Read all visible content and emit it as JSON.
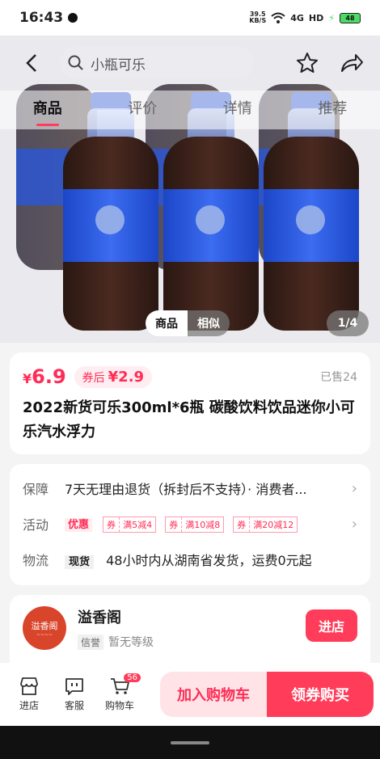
{
  "status": {
    "time": "16:43",
    "net_speed": "39.5\nKB/S",
    "hd": "HD",
    "signal": "4G",
    "battery": "48"
  },
  "nav": {
    "search_placeholder": "小瓶可乐"
  },
  "tabs": [
    {
      "label": "商品",
      "active": true
    },
    {
      "label": "评价"
    },
    {
      "label": "详情"
    },
    {
      "label": "推荐"
    }
  ],
  "gallery": {
    "toggle_goods": "商品",
    "toggle_similar": "相似",
    "counter": "1/4"
  },
  "product": {
    "price_symbol": "¥",
    "price": "6.9",
    "coupon_prefix": "券后",
    "coupon_price": "¥2.9",
    "sold": "已售24",
    "title": "2022新货可乐300ml*6瓶 碳酸饮料饮品迷你小可乐汽水浮力"
  },
  "info": {
    "guarantee_key": "保障",
    "guarantee_val": "7天无理由退货（拆封后不支持）· 消费者...",
    "activity_key": "活动",
    "activity_tag": "优惠",
    "coupons": [
      {
        "q": "券",
        "text": "满5减4"
      },
      {
        "q": "券",
        "text": "满10减8"
      },
      {
        "q": "券",
        "text": "满20减12"
      }
    ],
    "logistics_key": "物流",
    "logistics_tag": "现货",
    "logistics_val": "48小时内从湖南省发货，运费0元起"
  },
  "shop": {
    "logo_text": "溢香阁",
    "name": "溢香阁",
    "badge": "信誉",
    "level": "暂无等级",
    "enter": "进店"
  },
  "bottom": {
    "store": "进店",
    "service": "客服",
    "cart": "购物车",
    "cart_count": "56",
    "add_cart": "加入购物车",
    "buy": "领券购买"
  }
}
